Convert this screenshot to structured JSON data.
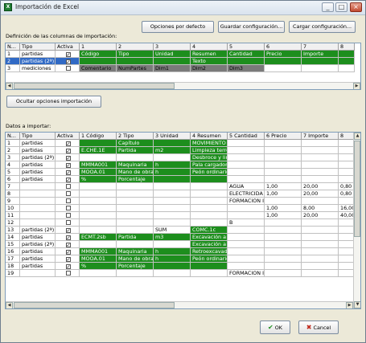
{
  "window": {
    "title": "Importación de Excel"
  },
  "toolbar": {
    "defaults_label": "Opciones por defecto",
    "save_config_label": "Guardar configuración...",
    "load_config_label": "Cargar configuración..."
  },
  "definition": {
    "label": "Definición de las columnas de importación:",
    "headers": [
      "N...",
      "Tipo",
      "Activa",
      "1",
      "2",
      "3",
      "4",
      "5",
      "6",
      "7",
      "8"
    ],
    "rows": [
      {
        "n": "1",
        "tipo": "partidas",
        "checked": "✓",
        "cells": [
          "Código",
          "Tipo",
          "Unidad",
          "Resumen",
          "Cantidad",
          "Precio",
          "Importe",
          ""
        ]
      },
      {
        "n": "2",
        "tipo": "partidas (2ª)",
        "checked": "✓",
        "cells": [
          "",
          "",
          "",
          "Texto",
          "",
          "",
          "",
          ""
        ]
      },
      {
        "n": "3",
        "tipo": "mediciones",
        "checked": "",
        "cells": [
          "Comentario",
          "NumPartes",
          "Dim1",
          "Dim2",
          "Dim3",
          "",
          "",
          ""
        ]
      }
    ]
  },
  "toggle_options_label": "Ocultar opciones importación",
  "import": {
    "label": "Datos a importar:",
    "headers": [
      "N...",
      "Tipo",
      "Activa",
      "1 Código",
      "2 Tipo",
      "3 Unidad",
      "4 Resumen",
      "5 Cantidad",
      "6 Precio",
      "7 Importe",
      "8"
    ],
    "rows": [
      {
        "n": "1",
        "tipo": "partidas",
        "checked": "✓",
        "cells": [
          "",
          "Capítulo",
          "",
          "MOVIMIENTO",
          "",
          "",
          "",
          ""
        ]
      },
      {
        "n": "2",
        "tipo": "partidas",
        "checked": "✓",
        "cells": [
          "E.CHE.1E",
          "Partida",
          "m2",
          "Limpieza terre",
          "",
          "",
          "",
          ""
        ]
      },
      {
        "n": "3",
        "tipo": "partidas (2ª)",
        "checked": "✓",
        "cells": [
          "",
          "",
          "",
          "Desbroce y lim",
          "",
          "",
          "",
          ""
        ]
      },
      {
        "n": "4",
        "tipo": "partidas",
        "checked": "✓",
        "cells": [
          "MMMA001",
          "Maquinaria",
          "h",
          "Pala cargadora",
          "",
          "",
          "",
          ""
        ]
      },
      {
        "n": "5",
        "tipo": "partidas",
        "checked": "✓",
        "cells": [
          "MOOA.01",
          "Mano de obra",
          "h",
          "Peón ordinario",
          "",
          "",
          "",
          ""
        ]
      },
      {
        "n": "6",
        "tipo": "partidas",
        "checked": "✓",
        "cells": [
          "%",
          "Porcentaje",
          "",
          "",
          "",
          "",
          "",
          ""
        ]
      },
      {
        "n": "7",
        "tipo": "",
        "checked": "",
        "cells": [
          "",
          "",
          "",
          "",
          "AGUA",
          "1,00",
          "20,00",
          "0,80"
        ]
      },
      {
        "n": "8",
        "tipo": "",
        "checked": "",
        "cells": [
          "",
          "",
          "",
          "",
          "ELECTRICIDA",
          "1,00",
          "20,00",
          "0,80"
        ]
      },
      {
        "n": "9",
        "tipo": "",
        "checked": "",
        "cells": [
          "",
          "",
          "",
          "",
          "FORMACION I",
          "",
          "",
          ""
        ]
      },
      {
        "n": "10",
        "tipo": "",
        "checked": "",
        "cells": [
          "",
          "",
          "",
          "",
          "",
          "1,00",
          "8,00",
          "16,00"
        ]
      },
      {
        "n": "11",
        "tipo": "",
        "checked": "",
        "cells": [
          "",
          "",
          "",
          "",
          "",
          "1,00",
          "20,00",
          "40,00"
        ]
      },
      {
        "n": "12",
        "tipo": "",
        "checked": "",
        "cells": [
          "",
          "",
          "",
          "",
          "B",
          "",
          "",
          ""
        ]
      },
      {
        "n": "13",
        "tipo": "partidas (2ª)",
        "checked": "✓",
        "cells": [
          "",
          "",
          "SUM",
          "COMC.1c",
          "",
          "",
          "",
          ""
        ]
      },
      {
        "n": "14",
        "tipo": "partidas",
        "checked": "✓",
        "cells": [
          "ECMT.2sb",
          "Partida",
          "m3",
          "Excavación a c",
          "",
          "",
          "",
          ""
        ]
      },
      {
        "n": "15",
        "tipo": "partidas (2ª)",
        "checked": "✓",
        "cells": [
          "",
          "",
          "",
          "Excavación a c",
          "",
          "",
          "",
          ""
        ]
      },
      {
        "n": "16",
        "tipo": "partidas",
        "checked": "✓",
        "cells": [
          "MMMA001",
          "Maquinaria",
          "h",
          "Retroexcavado",
          "",
          "",
          "",
          ""
        ]
      },
      {
        "n": "17",
        "tipo": "partidas",
        "checked": "✓",
        "cells": [
          "MOOA.01",
          "Mano de obra",
          "h",
          "Peón ordinario",
          "",
          "",
          "",
          ""
        ]
      },
      {
        "n": "18",
        "tipo": "partidas",
        "checked": "✓",
        "cells": [
          "%",
          "Porcentaje",
          "",
          "",
          "",
          "",
          "",
          ""
        ]
      },
      {
        "n": "19",
        "tipo": "",
        "checked": "",
        "cells": [
          "",
          "",
          "",
          "",
          "FORMACION I",
          "",
          "",
          ""
        ]
      }
    ]
  },
  "footer": {
    "ok_label": "OK",
    "cancel_label": "Cancel"
  },
  "colors": {
    "green": "#1d8e1d",
    "gray": "#7a7a7a",
    "selected": "#316ac5"
  }
}
